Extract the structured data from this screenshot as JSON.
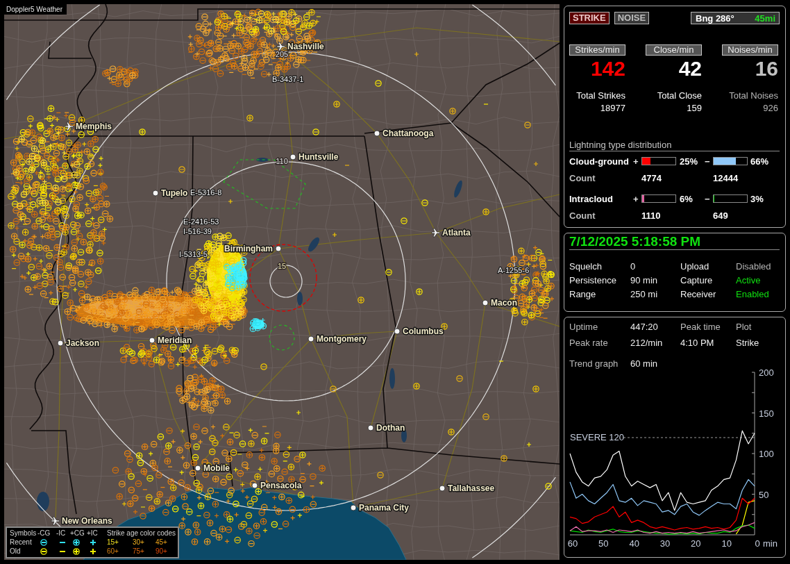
{
  "map": {
    "title": "Doppler5 Weather",
    "cities": [
      {
        "name": "Nashville",
        "kind": "airport"
      },
      {
        "name": "Memphis",
        "kind": "airport"
      },
      {
        "name": "Chattanooga",
        "kind": "city"
      },
      {
        "name": "Huntsville",
        "kind": "city"
      },
      {
        "name": "Tupelo",
        "kind": "city"
      },
      {
        "name": "Atlanta",
        "kind": "airport"
      },
      {
        "name": "Birmingham",
        "kind": "city"
      },
      {
        "name": "Macon",
        "kind": "city"
      },
      {
        "name": "Jackson",
        "kind": "city"
      },
      {
        "name": "Meridian",
        "kind": "city"
      },
      {
        "name": "Montgomery",
        "kind": "city"
      },
      {
        "name": "Columbus",
        "kind": "city"
      },
      {
        "name": "Dothan",
        "kind": "city"
      },
      {
        "name": "Mobile",
        "kind": "city"
      },
      {
        "name": "Pensacola",
        "kind": "city"
      },
      {
        "name": "Tallahassee",
        "kind": "city"
      },
      {
        "name": "Panama City",
        "kind": "city"
      },
      {
        "name": "New Orleans",
        "kind": "airport"
      }
    ],
    "ring_labels": [
      "205",
      "110",
      "15"
    ],
    "storm_labels": [
      "B-3437-1",
      "E-5316-8",
      "E-2416-53",
      "I-516-39",
      "I-5313-5",
      "A-1255-6"
    ],
    "legend": {
      "title": "Symbols",
      "symbols": [
        {
          "label": "-CG",
          "kind": "minus",
          "ring": true
        },
        {
          "label": "-IC",
          "kind": "minus",
          "ring": false
        },
        {
          "label": "+CG",
          "kind": "plus",
          "ring": true
        },
        {
          "label": "+IC",
          "kind": "plus",
          "ring": false
        }
      ],
      "age_title": "Strike age color codes",
      "rows": [
        {
          "label": "Recent",
          "color": "#30e0f0",
          "ages": [
            {
              "label": "15+",
              "color": "#f0e020"
            },
            {
              "label": "30+",
              "color": "#f0b020"
            },
            {
              "label": "45+",
              "color": "#e8a018"
            }
          ]
        },
        {
          "label": "Old",
          "color": "#f0f000",
          "ages": [
            {
              "label": "60+",
              "color": "#d88010"
            },
            {
              "label": "75+",
              "color": "#e06810"
            },
            {
              "label": "90+",
              "color": "#e04808"
            }
          ]
        }
      ]
    }
  },
  "strike_panel": {
    "modes": [
      {
        "label": "STRIKE",
        "selected": true
      },
      {
        "label": "NOISE",
        "selected": false
      }
    ],
    "bearing": "Bng 286°",
    "distance": "45mi",
    "stats": [
      {
        "header": "Strikes/min",
        "value": "142",
        "color": "#ff0000",
        "total_label": "Total Strikes",
        "total": "18977",
        "dimmed": false
      },
      {
        "header": "Close/min",
        "value": "42",
        "color": "#ffffff",
        "total_label": "Total Close",
        "total": "159",
        "dimmed": false
      },
      {
        "header": "Noises/min",
        "value": "16",
        "color": "#c0c0c0",
        "total_label": "Total Noises",
        "total": "926",
        "dimmed": true
      }
    ],
    "distribution": {
      "title": "Lightning type distribution",
      "rows": [
        {
          "label": "Cloud-ground",
          "count_label": "Count",
          "positive": {
            "sign": "+",
            "level": 0.25,
            "reading": "25%",
            "count": "4774",
            "color": "#ff0000"
          },
          "negative": {
            "sign": "−",
            "level": 0.66,
            "reading": "66%",
            "count": "12444",
            "color": "#90c8f8"
          }
        },
        {
          "label": "Intracloud",
          "count_label": "Count",
          "positive": {
            "sign": "+",
            "level": 0.06,
            "reading": "6%",
            "count": "1110",
            "color": "#e060a0"
          },
          "negative": {
            "sign": "−",
            "level": 0.03,
            "reading": "3%",
            "count": "649",
            "color": "#00d000"
          }
        }
      ]
    }
  },
  "status_panel": {
    "datetime": "7/12/2025 5:18:58 PM",
    "settings": [
      {
        "label": "Squelch",
        "value": "0"
      },
      {
        "label": "Persistence",
        "value": "90 min"
      },
      {
        "label": "Range",
        "value": "250 mi"
      }
    ],
    "services": [
      {
        "label": "Upload",
        "value": "Disabled",
        "on": false
      },
      {
        "label": "Capture",
        "value": "Active",
        "on": true
      },
      {
        "label": "Receiver",
        "value": "Enabled",
        "on": true
      }
    ]
  },
  "trend_panel": {
    "uptime": {
      "label": "Uptime",
      "value": "447:20"
    },
    "peak_rate": {
      "label": "Peak rate",
      "value": "212/min"
    },
    "peak_time": {
      "label": "Peak time",
      "value": "4:10 PM"
    },
    "plot": {
      "label": "Plot",
      "value": "Strike"
    },
    "trend": {
      "label": "Trend graph",
      "value": "60 min"
    },
    "severe_line": {
      "label": "SEVERE 120"
    },
    "chart_data": {
      "type": "line",
      "xlabel": "min",
      "x": [
        60,
        58,
        56,
        54,
        52,
        50,
        48,
        46,
        44,
        42,
        40,
        38,
        36,
        34,
        32,
        30,
        28,
        26,
        24,
        22,
        20,
        18,
        16,
        14,
        12,
        10,
        8,
        6,
        4,
        2,
        0
      ],
      "xlim": [
        60,
        0
      ],
      "ylim": [
        0,
        200
      ],
      "xticks": [
        60,
        50,
        40,
        30,
        20,
        10,
        0
      ],
      "yticks": [
        50,
        100,
        150,
        200
      ],
      "series": [
        {
          "color": "#ffffff",
          "values": [
            100,
            77,
            65,
            60,
            70,
            72,
            80,
            98,
            103,
            72,
            60,
            66,
            62,
            58,
            62,
            42,
            52,
            30,
            52,
            40,
            38,
            40,
            42,
            55,
            60,
            68,
            70,
            92,
            128,
            112,
            125
          ]
        },
        {
          "color": "#90c8f8",
          "values": [
            65,
            45,
            50,
            42,
            38,
            45,
            52,
            62,
            42,
            40,
            45,
            36,
            42,
            40,
            38,
            28,
            30,
            25,
            35,
            38,
            28,
            24,
            30,
            35,
            40,
            38,
            38,
            32,
            55,
            68,
            60
          ]
        },
        {
          "color": "#ff0000",
          "values": [
            22,
            20,
            14,
            16,
            22,
            25,
            28,
            35,
            22,
            28,
            15,
            18,
            15,
            10,
            8,
            10,
            8,
            6,
            8,
            9,
            7,
            8,
            10,
            8,
            9,
            7,
            9,
            18,
            45,
            38,
            45
          ]
        },
        {
          "color": "#f070b0",
          "values": [
            5,
            10,
            4,
            5,
            5,
            4,
            6,
            3,
            6,
            5,
            4,
            6,
            3,
            2,
            4,
            2,
            3,
            2,
            3,
            2,
            4,
            2,
            3,
            4,
            5,
            6,
            4,
            5,
            10,
            12,
            15
          ]
        },
        {
          "color": "#00e000",
          "values": [
            5,
            4,
            3,
            6,
            4,
            3,
            5,
            7,
            4,
            3,
            3,
            5,
            4,
            3,
            2,
            2,
            1,
            1,
            2,
            1,
            2,
            1,
            3,
            2,
            2,
            4,
            3,
            8,
            11,
            12,
            8
          ]
        },
        {
          "color": "#ffff00",
          "values": [
            null,
            null,
            null,
            null,
            null,
            null,
            null,
            null,
            null,
            null,
            null,
            null,
            null,
            null,
            null,
            null,
            null,
            null,
            null,
            null,
            null,
            null,
            null,
            null,
            null,
            null,
            null,
            1,
            12,
            40,
            42
          ]
        }
      ]
    }
  }
}
